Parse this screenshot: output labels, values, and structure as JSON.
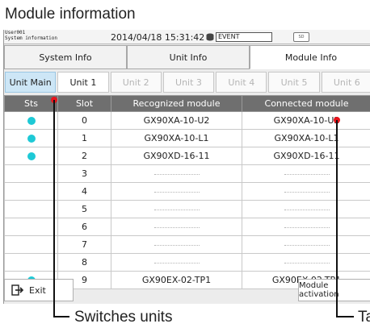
{
  "page_title": "Module information",
  "status_bar": {
    "user": "User001",
    "screen_name": "System information",
    "datetime": "2014/04/18 15:31:42",
    "event_label": "EVENT",
    "sd_label": "SD"
  },
  "tabs": [
    {
      "label": "System Info",
      "active": false
    },
    {
      "label": "Unit Info",
      "active": false
    },
    {
      "label": "Module Info",
      "active": true
    }
  ],
  "units": [
    {
      "label": "Unit Main",
      "state": "selected"
    },
    {
      "label": "Unit 1",
      "state": "enabled"
    },
    {
      "label": "Unit 2",
      "state": "disabled"
    },
    {
      "label": "Unit 3",
      "state": "disabled"
    },
    {
      "label": "Unit 4",
      "state": "disabled"
    },
    {
      "label": "Unit 5",
      "state": "disabled"
    },
    {
      "label": "Unit 6",
      "state": "disabled"
    }
  ],
  "table": {
    "headers": [
      "Sts",
      "Slot",
      "Recognized module",
      "Connected module"
    ],
    "rows": [
      {
        "status": true,
        "slot": "0",
        "recognized": "GX90XA-10-U2",
        "connected": "GX90XA-10-U2"
      },
      {
        "status": true,
        "slot": "1",
        "recognized": "GX90XA-10-L1",
        "connected": "GX90XA-10-L1"
      },
      {
        "status": true,
        "slot": "2",
        "recognized": "GX90XD-16-11",
        "connected": "GX90XD-16-11"
      },
      {
        "status": false,
        "slot": "3",
        "recognized": "",
        "connected": ""
      },
      {
        "status": false,
        "slot": "4",
        "recognized": "",
        "connected": ""
      },
      {
        "status": false,
        "slot": "5",
        "recognized": "",
        "connected": ""
      },
      {
        "status": false,
        "slot": "6",
        "recognized": "",
        "connected": ""
      },
      {
        "status": false,
        "slot": "7",
        "recognized": "",
        "connected": ""
      },
      {
        "status": false,
        "slot": "8",
        "recognized": "",
        "connected": ""
      },
      {
        "status": true,
        "slot": "9",
        "recognized": "GX90EX-02-TP1",
        "connected": "GX90EX-02-TP1"
      }
    ]
  },
  "buttons": {
    "exit": "Exit",
    "activate": "Module activation"
  },
  "callouts": {
    "units": "Switches units",
    "right_truncated": "Ta"
  },
  "colors": {
    "status_ok": "#1ec9d6",
    "selected_unit": "#cde6f6",
    "header_bg": "#6f6f6f",
    "callout_dot": "#e8141c"
  },
  "icons": {
    "exit": "exit-arrow-icon",
    "db": "database-icon",
    "sd": "sd-card-icon",
    "status": "status-dot-icon"
  }
}
